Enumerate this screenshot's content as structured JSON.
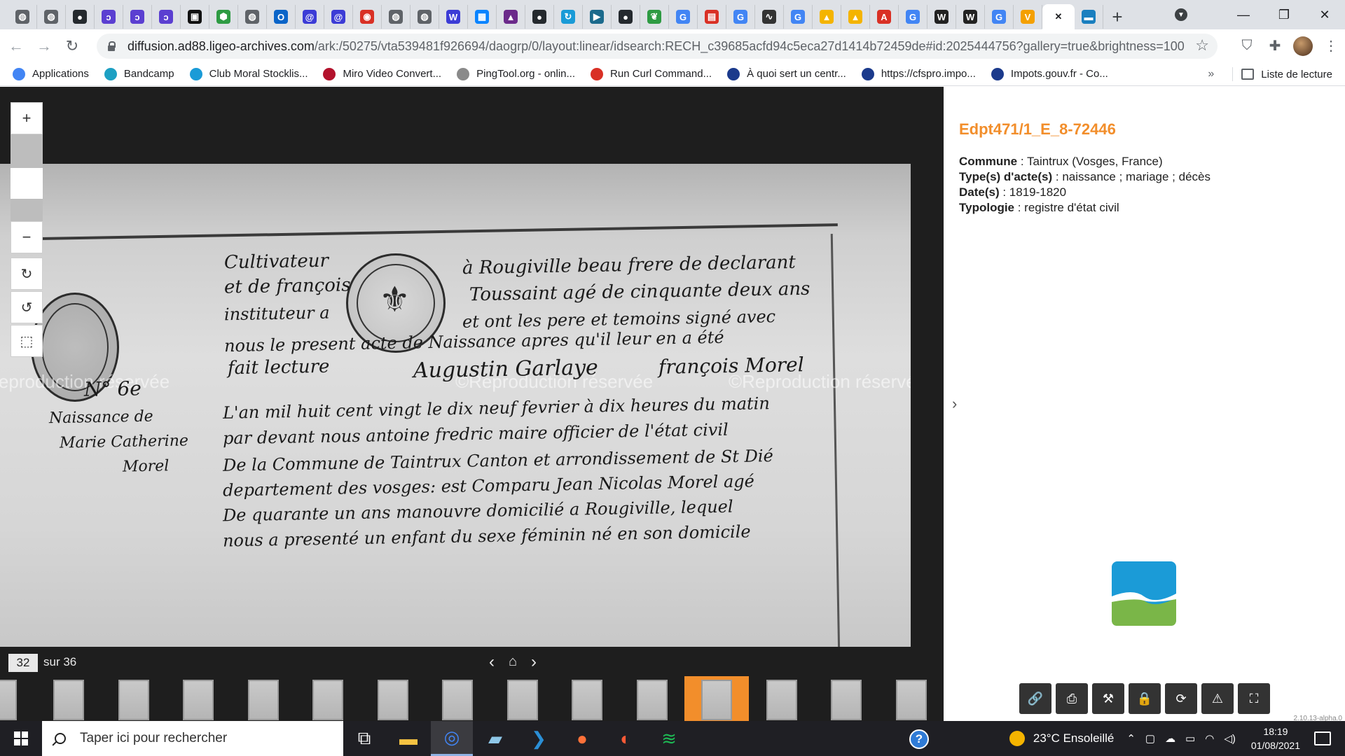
{
  "browser": {
    "tabs": [
      {
        "icon": "globe-icon",
        "color": "#5f6368",
        "glyph": "◍"
      },
      {
        "icon": "globe-icon",
        "color": "#5f6368",
        "glyph": "◍"
      },
      {
        "icon": "github-icon",
        "color": "#24292e",
        "glyph": "●"
      },
      {
        "icon": "bracket-icon",
        "color": "#5b3fd1",
        "glyph": "ↄ"
      },
      {
        "icon": "bracket-icon",
        "color": "#5b3fd1",
        "glyph": "ↄ"
      },
      {
        "icon": "bracket-icon",
        "color": "#5b3fd1",
        "glyph": "ↄ"
      },
      {
        "icon": "notion-icon",
        "color": "#111111",
        "glyph": "▣"
      },
      {
        "icon": "cube-icon",
        "color": "#2e9b43",
        "glyph": "⬢"
      },
      {
        "icon": "globe-icon",
        "color": "#5f6368",
        "glyph": "◍"
      },
      {
        "icon": "outlook-icon",
        "color": "#0a64c8",
        "glyph": "O"
      },
      {
        "icon": "webflow-icon",
        "color": "#3c3cd6",
        "glyph": "@"
      },
      {
        "icon": "webflow-icon",
        "color": "#3c3cd6",
        "glyph": "@"
      },
      {
        "icon": "record-icon",
        "color": "#d93025",
        "glyph": "◉"
      },
      {
        "icon": "globe-icon",
        "color": "#5f6368",
        "glyph": "◍"
      },
      {
        "icon": "globe-icon",
        "color": "#5f6368",
        "glyph": "◍"
      },
      {
        "icon": "webflow-icon",
        "color": "#3c3cd6",
        "glyph": "W"
      },
      {
        "icon": "windows-icon",
        "color": "#0a84ff",
        "glyph": "▦"
      },
      {
        "icon": "photo-icon",
        "color": "#6b2a8a",
        "glyph": "▲"
      },
      {
        "icon": "github-icon",
        "color": "#24292e",
        "glyph": "●"
      },
      {
        "icon": "refresh-app-icon",
        "color": "#1a9bd7",
        "glyph": "↻"
      },
      {
        "icon": "route-icon",
        "color": "#1b6a8c",
        "glyph": "▶"
      },
      {
        "icon": "github-icon",
        "color": "#24292e",
        "glyph": "●"
      },
      {
        "icon": "leaf-icon",
        "color": "#2e9b43",
        "glyph": "❦"
      },
      {
        "icon": "google-icon",
        "color": "#4285f4",
        "glyph": "G"
      },
      {
        "icon": "news-icon",
        "color": "#d93025",
        "glyph": "▤"
      },
      {
        "icon": "google-icon",
        "color": "#4285f4",
        "glyph": "G"
      },
      {
        "icon": "signature-icon",
        "color": "#333333",
        "glyph": "∿"
      },
      {
        "icon": "google-icon",
        "color": "#4285f4",
        "glyph": "G"
      },
      {
        "icon": "drive-icon",
        "color": "#f4b400",
        "glyph": "▲"
      },
      {
        "icon": "drive-icon",
        "color": "#f4b400",
        "glyph": "▲"
      },
      {
        "icon": "acrobat-icon",
        "color": "#d93025",
        "glyph": "A"
      },
      {
        "icon": "google-icon",
        "color": "#4285f4",
        "glyph": "G"
      },
      {
        "icon": "wikipedia-icon",
        "color": "#222222",
        "glyph": "W"
      },
      {
        "icon": "wikipedia-icon",
        "color": "#222222",
        "glyph": "W"
      },
      {
        "icon": "google-icon",
        "color": "#4285f4",
        "glyph": "G"
      },
      {
        "icon": "vivaldi-icon",
        "color": "#f4a000",
        "glyph": "V"
      },
      {
        "icon": "close-icon",
        "color": "#202124",
        "glyph": "✕",
        "active": true
      },
      {
        "icon": "ligeo-icon",
        "color": "#1a7fbf",
        "glyph": "▬"
      }
    ],
    "new_tab": "+",
    "url_host": "diffusion.ad88.ligeo-archives.com",
    "url_path": "/ark:/50275/vta539481f926694/daogrp/0/layout:linear/idsearch:RECH_c39685acfd94c5eca27d1414b72459de#id:2025444756?gallery=true&brightness=100.00&c...",
    "bookmarks": [
      {
        "label": "Applications",
        "icon": "apps-grid-icon",
        "color": "#4285f4"
      },
      {
        "label": "Bandcamp",
        "icon": "bandcamp-icon",
        "color": "#1da0c3"
      },
      {
        "label": "Club Moral Stocklis...",
        "icon": "club-icon",
        "color": "#1a9bd7"
      },
      {
        "label": "Miro Video Convert...",
        "icon": "miro-icon",
        "color": "#b3122c"
      },
      {
        "label": "PingTool.org - onlin...",
        "icon": "globe-icon",
        "color": "#8a8a8a"
      },
      {
        "label": "Run Curl Command...",
        "icon": "curl-icon",
        "color": "#d93025"
      },
      {
        "label": "À quoi sert un centr...",
        "icon": "flag-icon",
        "color": "#1b3a8c"
      },
      {
        "label": "https://cfspro.impo...",
        "icon": "impots-icon",
        "color": "#1b3a8c"
      },
      {
        "label": "Impots.gouv.fr - Co...",
        "icon": "impots-icon",
        "color": "#1b3a8c"
      }
    ],
    "bookmarks_more": "»",
    "reading_list": "Liste de lecture"
  },
  "viewer": {
    "zoom_in": "+",
    "zoom_out": "−",
    "rotate_right": "↻",
    "rotate_left": "↺",
    "select": "⬚",
    "page_current": "32",
    "page_total_label": "sur 36",
    "prev": "‹",
    "next": "›",
    "gallery": "⌂",
    "thumbnails_count": 14,
    "selected_thumbnail": 10,
    "watermark": "©Reproduction réservée",
    "handwriting": [
      "Cultivateur",
      "à Rougiville beau frere de declarant",
      "et de françois",
      "Toussaint agé de cinquante deux ans",
      "instituteur a",
      "et ont les pere et temoins signé avec",
      "nous le present acte de Naissance apres qu'il leur en a été",
      "fait lecture",
      "Augustin Garlaye",
      "françois Morel",
      "N° 6e",
      "L'an mil huit cent vingt le dix neuf fevrier à dix heures du matin",
      "par devant nous antoine fredric maire officier de l'état civil",
      "De la Commune de Taintrux Canton et arrondissement de St Dié",
      "departement des vosges: est Comparu Jean Nicolas Morel agé",
      "De quarante un ans manouvre domicilié a Rougiville, lequel",
      "nous a presenté un enfant du sexe féminin né en son domicile",
      "Naissance de",
      "Marie Catherine",
      "Morel"
    ]
  },
  "record": {
    "title": "Edpt471/1_E_8-72446",
    "fields": [
      {
        "label": "Commune",
        "value": " : Taintrux (Vosges, France)"
      },
      {
        "label": "Type(s) d'acte(s)",
        "value": " : naissance ; mariage ; décès"
      },
      {
        "label": "Date(s)",
        "value": " : 1819-1820"
      },
      {
        "label": "Typologie",
        "value": " : registre d'état civil"
      }
    ],
    "panel_toggle": "›",
    "version": "2.10.13-alpha.0",
    "actions": [
      {
        "name": "link-button",
        "icon": "link-icon",
        "glyph": "🔗"
      },
      {
        "name": "print-button",
        "icon": "printer-icon",
        "glyph": "⎙"
      },
      {
        "name": "tools-button",
        "icon": "hammer-icon",
        "glyph": "⚒"
      },
      {
        "name": "lock-button",
        "icon": "lock-icon",
        "glyph": "🔒"
      },
      {
        "name": "refresh-button",
        "icon": "refresh-icon",
        "glyph": "⟳"
      },
      {
        "name": "report-button",
        "icon": "warning-icon",
        "glyph": "⚠"
      },
      {
        "name": "fullscreen-button",
        "icon": "fullscreen-icon",
        "glyph": "⛶"
      }
    ]
  },
  "taskbar": {
    "search_placeholder": "Taper ici pour rechercher",
    "weather": "23°C Ensoleillé",
    "time": "18:19",
    "date": "01/08/2021",
    "apps": [
      {
        "name": "task-view",
        "icon": "task-view-icon",
        "color": "#ffffff",
        "glyph": "⧉"
      },
      {
        "name": "file-explorer",
        "icon": "folder-icon",
        "color": "#f5c342",
        "glyph": "▬"
      },
      {
        "name": "chrome",
        "icon": "chrome-icon",
        "color": "#4285f4",
        "glyph": "◎",
        "active": true
      },
      {
        "name": "notepad",
        "icon": "notepad-icon",
        "color": "#8ec7e8",
        "glyph": "▰"
      },
      {
        "name": "vscode",
        "icon": "vscode-icon",
        "color": "#2b8fd6",
        "glyph": "❯"
      },
      {
        "name": "firefox",
        "icon": "firefox-icon",
        "color": "#ff7139",
        "glyph": "●"
      },
      {
        "name": "app-orange",
        "icon": "compass-icon",
        "color": "#ff5a36",
        "glyph": "◐"
      },
      {
        "name": "spotify",
        "icon": "spotify-icon",
        "color": "#1db954",
        "glyph": "≋"
      }
    ]
  }
}
